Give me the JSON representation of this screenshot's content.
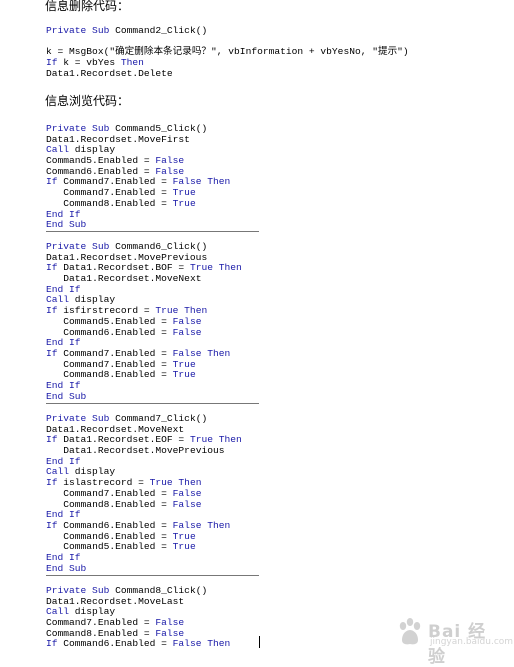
{
  "sections": [
    {
      "heading": "信息删除代码：",
      "lines": [
        {
          "indent": "",
          "tokens": [
            {
              "k": 1,
              "t": "Private Sub"
            },
            {
              "k": 0,
              "t": " Command2_Click()"
            }
          ]
        },
        {
          "indent": "",
          "tokens": []
        },
        {
          "indent": "",
          "tokens": [
            {
              "k": 0,
              "t": "k = MsgBox(\"确定删除本条记录吗？\", vbInformation + vbYesNo, \"提示\")"
            }
          ]
        },
        {
          "indent": "",
          "tokens": [
            {
              "k": 1,
              "t": "If"
            },
            {
              "k": 0,
              "t": " k = vbYes "
            },
            {
              "k": 1,
              "t": "Then"
            }
          ]
        },
        {
          "indent": "",
          "tokens": [
            {
              "k": 0,
              "t": "Data1.Recordset.Delete"
            }
          ]
        }
      ]
    },
    {
      "heading": "信息浏览代码：",
      "blocks": [
        [
          {
            "indent": "",
            "tokens": [
              {
                "k": 1,
                "t": "Private Sub"
              },
              {
                "k": 0,
                "t": " Command5_Click()"
              }
            ]
          },
          {
            "indent": "",
            "tokens": [
              {
                "k": 0,
                "t": "Data1.Recordset.MoveFirst"
              }
            ]
          },
          {
            "indent": "",
            "tokens": [
              {
                "k": 1,
                "t": "Call"
              },
              {
                "k": 0,
                "t": " display"
              }
            ]
          },
          {
            "indent": "",
            "tokens": [
              {
                "k": 0,
                "t": "Command5.Enabled = "
              },
              {
                "k": 1,
                "t": "False"
              }
            ]
          },
          {
            "indent": "",
            "tokens": [
              {
                "k": 0,
                "t": "Command6.Enabled = "
              },
              {
                "k": 1,
                "t": "False"
              }
            ]
          },
          {
            "indent": "",
            "tokens": [
              {
                "k": 1,
                "t": "If"
              },
              {
                "k": 0,
                "t": " Command7.Enabled = "
              },
              {
                "k": 1,
                "t": "False Then"
              }
            ]
          },
          {
            "indent": "   ",
            "tokens": [
              {
                "k": 0,
                "t": "Command7.Enabled = "
              },
              {
                "k": 1,
                "t": "True"
              }
            ]
          },
          {
            "indent": "   ",
            "tokens": [
              {
                "k": 0,
                "t": "Command8.Enabled = "
              },
              {
                "k": 1,
                "t": "True"
              }
            ]
          },
          {
            "indent": "",
            "tokens": [
              {
                "k": 1,
                "t": "End If"
              }
            ]
          },
          {
            "indent": "",
            "tokens": [
              {
                "k": 1,
                "t": "End Sub"
              }
            ]
          }
        ],
        [
          {
            "indent": "",
            "tokens": [
              {
                "k": 1,
                "t": "Private Sub"
              },
              {
                "k": 0,
                "t": " Command6_Click()"
              }
            ]
          },
          {
            "indent": "",
            "tokens": [
              {
                "k": 0,
                "t": "Data1.Recordset.MovePrevious"
              }
            ]
          },
          {
            "indent": "",
            "tokens": [
              {
                "k": 1,
                "t": "If"
              },
              {
                "k": 0,
                "t": " Data1.Recordset.BOF = "
              },
              {
                "k": 1,
                "t": "True Then"
              }
            ]
          },
          {
            "indent": "   ",
            "tokens": [
              {
                "k": 0,
                "t": "Data1.Recordset.MoveNext"
              }
            ]
          },
          {
            "indent": "",
            "tokens": [
              {
                "k": 1,
                "t": "End If"
              }
            ]
          },
          {
            "indent": "",
            "tokens": [
              {
                "k": 1,
                "t": "Call"
              },
              {
                "k": 0,
                "t": " display"
              }
            ]
          },
          {
            "indent": "",
            "tokens": [
              {
                "k": 1,
                "t": "If"
              },
              {
                "k": 0,
                "t": " isfirstrecord = "
              },
              {
                "k": 1,
                "t": "True Then"
              }
            ]
          },
          {
            "indent": "   ",
            "tokens": [
              {
                "k": 0,
                "t": "Command5.Enabled = "
              },
              {
                "k": 1,
                "t": "False"
              }
            ]
          },
          {
            "indent": "   ",
            "tokens": [
              {
                "k": 0,
                "t": "Command6.Enabled = "
              },
              {
                "k": 1,
                "t": "False"
              }
            ]
          },
          {
            "indent": "",
            "tokens": [
              {
                "k": 1,
                "t": "End If"
              }
            ]
          },
          {
            "indent": "",
            "tokens": [
              {
                "k": 1,
                "t": "If"
              },
              {
                "k": 0,
                "t": " Command7.Enabled = "
              },
              {
                "k": 1,
                "t": "False Then"
              }
            ]
          },
          {
            "indent": "   ",
            "tokens": [
              {
                "k": 0,
                "t": "Command7.Enabled = "
              },
              {
                "k": 1,
                "t": "True"
              }
            ]
          },
          {
            "indent": "   ",
            "tokens": [
              {
                "k": 0,
                "t": "Command8.Enabled = "
              },
              {
                "k": 1,
                "t": "True"
              }
            ]
          },
          {
            "indent": "",
            "tokens": [
              {
                "k": 1,
                "t": "End If"
              }
            ]
          },
          {
            "indent": "",
            "tokens": [
              {
                "k": 1,
                "t": "End Sub"
              }
            ]
          }
        ],
        [
          {
            "indent": "",
            "tokens": [
              {
                "k": 1,
                "t": "Private Sub"
              },
              {
                "k": 0,
                "t": " Command7_Click()"
              }
            ]
          },
          {
            "indent": "",
            "tokens": [
              {
                "k": 0,
                "t": "Data1.Recordset.MoveNext"
              }
            ]
          },
          {
            "indent": "",
            "tokens": [
              {
                "k": 1,
                "t": "If"
              },
              {
                "k": 0,
                "t": " Data1.Recordset.EOF = "
              },
              {
                "k": 1,
                "t": "True Then"
              }
            ]
          },
          {
            "indent": "   ",
            "tokens": [
              {
                "k": 0,
                "t": "Data1.Recordset.MovePrevious"
              }
            ]
          },
          {
            "indent": "",
            "tokens": [
              {
                "k": 1,
                "t": "End If"
              }
            ]
          },
          {
            "indent": "",
            "tokens": [
              {
                "k": 1,
                "t": "Call"
              },
              {
                "k": 0,
                "t": " display"
              }
            ]
          },
          {
            "indent": "",
            "tokens": [
              {
                "k": 1,
                "t": "If"
              },
              {
                "k": 0,
                "t": " islastrecord = "
              },
              {
                "k": 1,
                "t": "True Then"
              }
            ]
          },
          {
            "indent": "   ",
            "tokens": [
              {
                "k": 0,
                "t": "Command7.Enabled = "
              },
              {
                "k": 1,
                "t": "False"
              }
            ]
          },
          {
            "indent": "   ",
            "tokens": [
              {
                "k": 0,
                "t": "Command8.Enabled = "
              },
              {
                "k": 1,
                "t": "False"
              }
            ]
          },
          {
            "indent": "",
            "tokens": [
              {
                "k": 1,
                "t": "End If"
              }
            ]
          },
          {
            "indent": "",
            "tokens": [
              {
                "k": 1,
                "t": "If"
              },
              {
                "k": 0,
                "t": " Command6.Enabled = "
              },
              {
                "k": 1,
                "t": "False Then"
              }
            ]
          },
          {
            "indent": "   ",
            "tokens": [
              {
                "k": 0,
                "t": "Command6.Enabled = "
              },
              {
                "k": 1,
                "t": "True"
              }
            ]
          },
          {
            "indent": "   ",
            "tokens": [
              {
                "k": 0,
                "t": "Command5.Enabled = "
              },
              {
                "k": 1,
                "t": "True"
              }
            ]
          },
          {
            "indent": "",
            "tokens": [
              {
                "k": 1,
                "t": "End If"
              }
            ]
          },
          {
            "indent": "",
            "tokens": [
              {
                "k": 1,
                "t": "End Sub"
              }
            ]
          }
        ],
        [
          {
            "indent": "",
            "tokens": [
              {
                "k": 1,
                "t": "Private Sub"
              },
              {
                "k": 0,
                "t": " Command8_Click()"
              }
            ]
          },
          {
            "indent": "",
            "tokens": [
              {
                "k": 0,
                "t": "Data1.Recordset.MoveLast"
              }
            ]
          },
          {
            "indent": "",
            "tokens": [
              {
                "k": 1,
                "t": "Call"
              },
              {
                "k": 0,
                "t": " display"
              }
            ]
          },
          {
            "indent": "",
            "tokens": [
              {
                "k": 0,
                "t": "Command7.Enabled = "
              },
              {
                "k": 1,
                "t": "False"
              }
            ]
          },
          {
            "indent": "",
            "tokens": [
              {
                "k": 0,
                "t": "Command8.Enabled = "
              },
              {
                "k": 1,
                "t": "False"
              }
            ]
          },
          {
            "indent": "",
            "tokens": [
              {
                "k": 1,
                "t": "If"
              },
              {
                "k": 0,
                "t": " Command6.Enabled = "
              },
              {
                "k": 1,
                "t": "False Then"
              }
            ]
          }
        ]
      ]
    }
  ],
  "watermark": {
    "text": "Bai 经验",
    "sub": "jingyan.baidu.com"
  },
  "colors": {
    "keyword": "#1a1aa8",
    "text": "#000000",
    "rule": "#777777"
  }
}
